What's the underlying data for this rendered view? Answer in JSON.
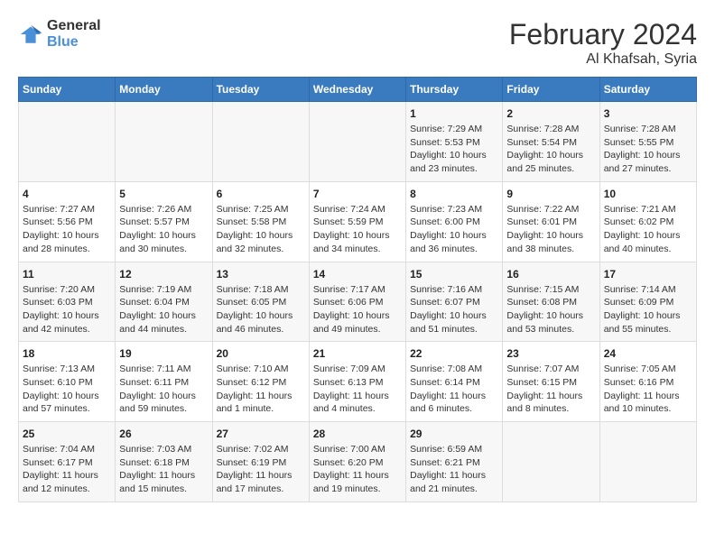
{
  "header": {
    "logo": {
      "line1": "General",
      "line2": "Blue"
    },
    "title": "February 2024",
    "location": "Al Khafsah, Syria"
  },
  "calendar": {
    "days_of_week": [
      "Sunday",
      "Monday",
      "Tuesday",
      "Wednesday",
      "Thursday",
      "Friday",
      "Saturday"
    ],
    "weeks": [
      [
        {
          "day": "",
          "info": ""
        },
        {
          "day": "",
          "info": ""
        },
        {
          "day": "",
          "info": ""
        },
        {
          "day": "",
          "info": ""
        },
        {
          "day": "1",
          "info": "Sunrise: 7:29 AM\nSunset: 5:53 PM\nDaylight: 10 hours\nand 23 minutes."
        },
        {
          "day": "2",
          "info": "Sunrise: 7:28 AM\nSunset: 5:54 PM\nDaylight: 10 hours\nand 25 minutes."
        },
        {
          "day": "3",
          "info": "Sunrise: 7:28 AM\nSunset: 5:55 PM\nDaylight: 10 hours\nand 27 minutes."
        }
      ],
      [
        {
          "day": "4",
          "info": "Sunrise: 7:27 AM\nSunset: 5:56 PM\nDaylight: 10 hours\nand 28 minutes."
        },
        {
          "day": "5",
          "info": "Sunrise: 7:26 AM\nSunset: 5:57 PM\nDaylight: 10 hours\nand 30 minutes."
        },
        {
          "day": "6",
          "info": "Sunrise: 7:25 AM\nSunset: 5:58 PM\nDaylight: 10 hours\nand 32 minutes."
        },
        {
          "day": "7",
          "info": "Sunrise: 7:24 AM\nSunset: 5:59 PM\nDaylight: 10 hours\nand 34 minutes."
        },
        {
          "day": "8",
          "info": "Sunrise: 7:23 AM\nSunset: 6:00 PM\nDaylight: 10 hours\nand 36 minutes."
        },
        {
          "day": "9",
          "info": "Sunrise: 7:22 AM\nSunset: 6:01 PM\nDaylight: 10 hours\nand 38 minutes."
        },
        {
          "day": "10",
          "info": "Sunrise: 7:21 AM\nSunset: 6:02 PM\nDaylight: 10 hours\nand 40 minutes."
        }
      ],
      [
        {
          "day": "11",
          "info": "Sunrise: 7:20 AM\nSunset: 6:03 PM\nDaylight: 10 hours\nand 42 minutes."
        },
        {
          "day": "12",
          "info": "Sunrise: 7:19 AM\nSunset: 6:04 PM\nDaylight: 10 hours\nand 44 minutes."
        },
        {
          "day": "13",
          "info": "Sunrise: 7:18 AM\nSunset: 6:05 PM\nDaylight: 10 hours\nand 46 minutes."
        },
        {
          "day": "14",
          "info": "Sunrise: 7:17 AM\nSunset: 6:06 PM\nDaylight: 10 hours\nand 49 minutes."
        },
        {
          "day": "15",
          "info": "Sunrise: 7:16 AM\nSunset: 6:07 PM\nDaylight: 10 hours\nand 51 minutes."
        },
        {
          "day": "16",
          "info": "Sunrise: 7:15 AM\nSunset: 6:08 PM\nDaylight: 10 hours\nand 53 minutes."
        },
        {
          "day": "17",
          "info": "Sunrise: 7:14 AM\nSunset: 6:09 PM\nDaylight: 10 hours\nand 55 minutes."
        }
      ],
      [
        {
          "day": "18",
          "info": "Sunrise: 7:13 AM\nSunset: 6:10 PM\nDaylight: 10 hours\nand 57 minutes."
        },
        {
          "day": "19",
          "info": "Sunrise: 7:11 AM\nSunset: 6:11 PM\nDaylight: 10 hours\nand 59 minutes."
        },
        {
          "day": "20",
          "info": "Sunrise: 7:10 AM\nSunset: 6:12 PM\nDaylight: 11 hours\nand 1 minute."
        },
        {
          "day": "21",
          "info": "Sunrise: 7:09 AM\nSunset: 6:13 PM\nDaylight: 11 hours\nand 4 minutes."
        },
        {
          "day": "22",
          "info": "Sunrise: 7:08 AM\nSunset: 6:14 PM\nDaylight: 11 hours\nand 6 minutes."
        },
        {
          "day": "23",
          "info": "Sunrise: 7:07 AM\nSunset: 6:15 PM\nDaylight: 11 hours\nand 8 minutes."
        },
        {
          "day": "24",
          "info": "Sunrise: 7:05 AM\nSunset: 6:16 PM\nDaylight: 11 hours\nand 10 minutes."
        }
      ],
      [
        {
          "day": "25",
          "info": "Sunrise: 7:04 AM\nSunset: 6:17 PM\nDaylight: 11 hours\nand 12 minutes."
        },
        {
          "day": "26",
          "info": "Sunrise: 7:03 AM\nSunset: 6:18 PM\nDaylight: 11 hours\nand 15 minutes."
        },
        {
          "day": "27",
          "info": "Sunrise: 7:02 AM\nSunset: 6:19 PM\nDaylight: 11 hours\nand 17 minutes."
        },
        {
          "day": "28",
          "info": "Sunrise: 7:00 AM\nSunset: 6:20 PM\nDaylight: 11 hours\nand 19 minutes."
        },
        {
          "day": "29",
          "info": "Sunrise: 6:59 AM\nSunset: 6:21 PM\nDaylight: 11 hours\nand 21 minutes."
        },
        {
          "day": "",
          "info": ""
        },
        {
          "day": "",
          "info": ""
        }
      ]
    ]
  }
}
